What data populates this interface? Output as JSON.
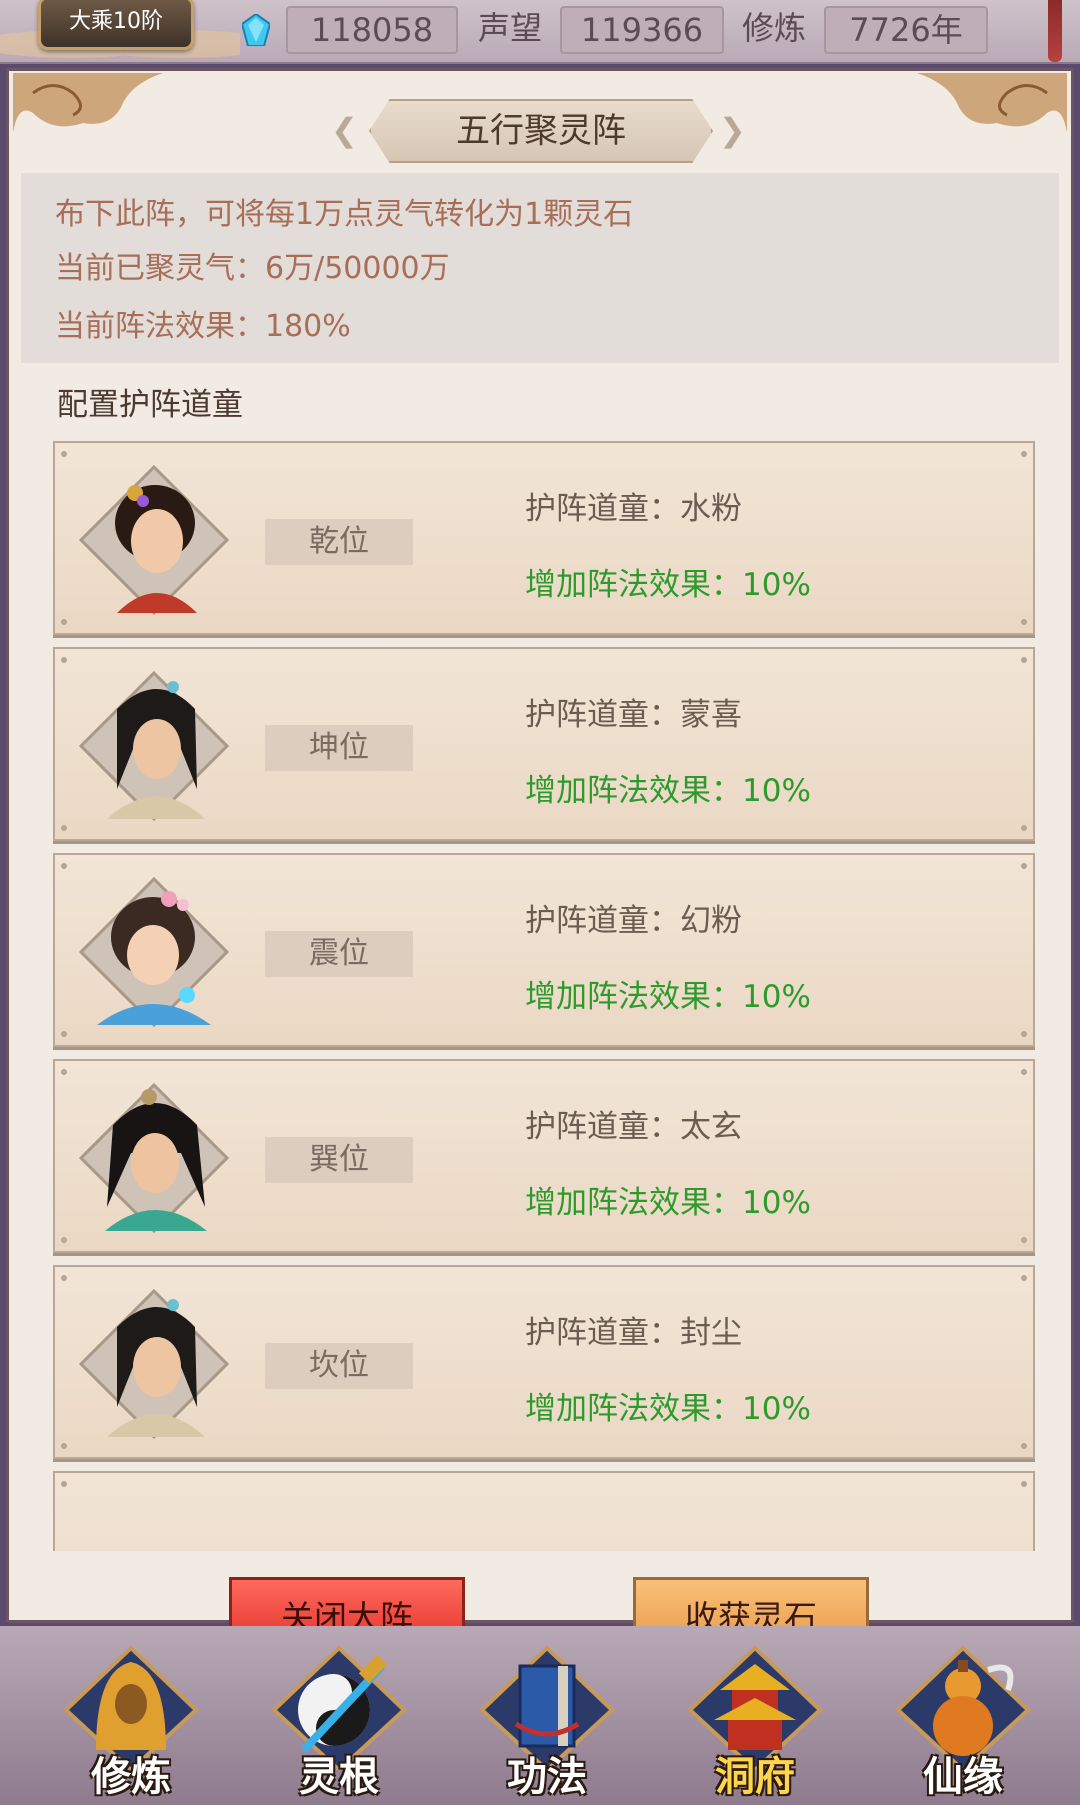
{
  "topbar": {
    "rank": "大乘10阶",
    "gem_value": "118058",
    "reputation_label": "声望",
    "reputation_value": "119366",
    "cultivation_label": "修炼",
    "cultivation_value": "7726年",
    "gem_icon": "spirit-gem-icon"
  },
  "panel": {
    "title": "五行聚灵阵",
    "info": {
      "line1": "布下此阵，可将每1万点灵气转化为1颗灵石",
      "line2": "当前已聚灵气：6万/50000万",
      "line3": "当前阵法效果：180%"
    },
    "section_title": "配置护阵道童",
    "rows": [
      {
        "position": "乾位",
        "guard": "护阵道童：水粉",
        "effect": "增加阵法效果：10%"
      },
      {
        "position": "坤位",
        "guard": "护阵道童：蒙喜",
        "effect": "增加阵法效果：10%"
      },
      {
        "position": "震位",
        "guard": "护阵道童：幻粉",
        "effect": "增加阵法效果：10%"
      },
      {
        "position": "巽位",
        "guard": "护阵道童：太玄",
        "effect": "增加阵法效果：10%"
      },
      {
        "position": "坎位",
        "guard": "护阵道童：封尘",
        "effect": "增加阵法效果：10%"
      }
    ],
    "buttons": {
      "close": "关闭大阵",
      "harvest": "收获灵石"
    }
  },
  "bottom_nav": [
    {
      "label": "修炼",
      "icon": "hooded-monk-icon"
    },
    {
      "label": "灵根",
      "icon": "yin-yang-sword-icon"
    },
    {
      "label": "功法",
      "icon": "scroll-book-icon"
    },
    {
      "label": "洞府",
      "icon": "pagoda-icon",
      "active": true
    },
    {
      "label": "仙缘",
      "icon": "gourd-icon"
    }
  ],
  "colors": {
    "effect_green": "#2f9a2c",
    "info_text": "#a86e58",
    "close_button": "#e0302a",
    "harvest_button": "#e89a48",
    "active_nav": "#ffd54a"
  }
}
